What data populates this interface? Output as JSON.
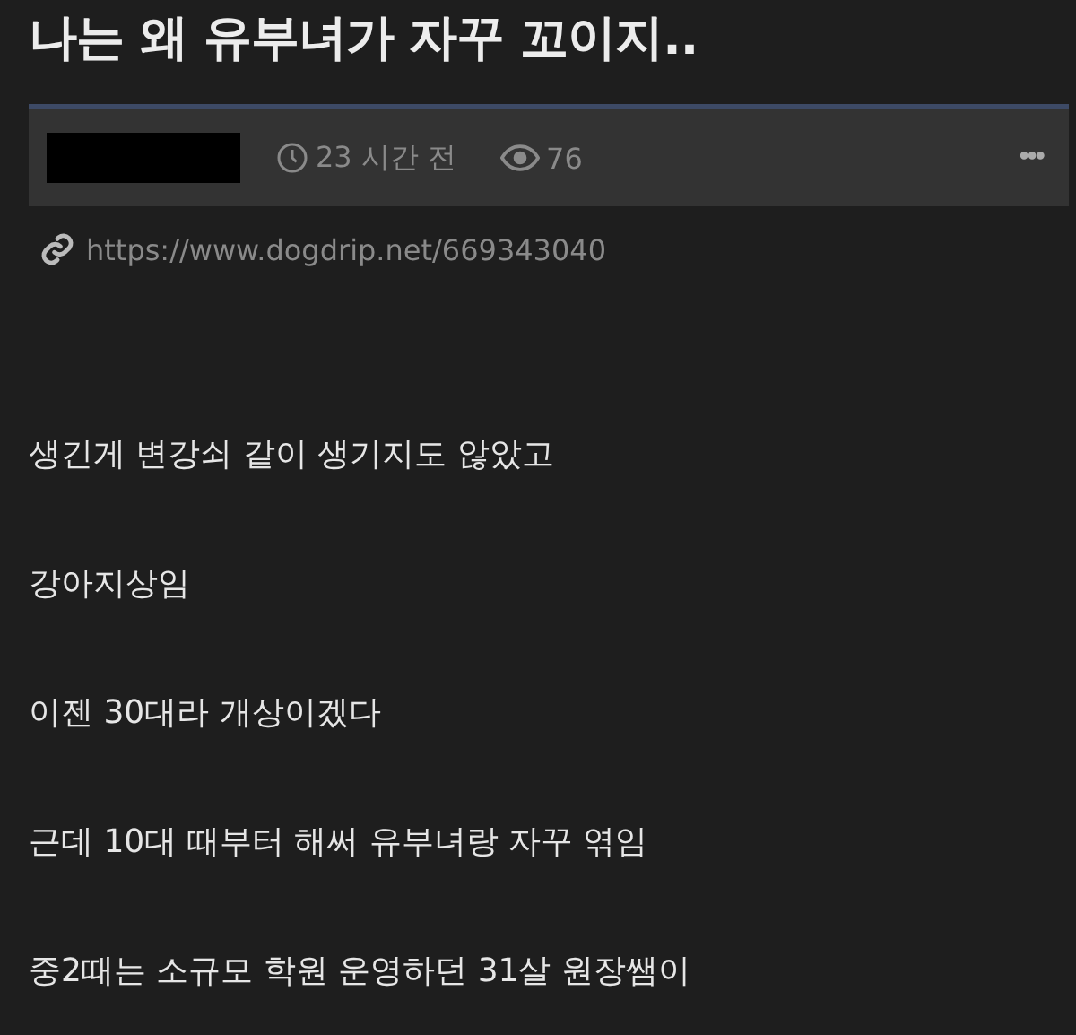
{
  "title": "나는 왜 유부녀가 자꾸 꼬이지..",
  "meta": {
    "author_redacted": true,
    "time": "23 시간 전",
    "views": "76",
    "more": "•••"
  },
  "link": "https://www.dogdrip.net/669343040",
  "paragraphs": [
    "생긴게 변강쇠 같이 생기지도 않았고",
    "강아지상임",
    "이젠 30대라 개상이겠다",
    "근데 10대 때부터 해써 유부녀랑 자꾸 엮임",
    "중2때는 소규모 학원 운영하던 31살 원장쌤이"
  ]
}
